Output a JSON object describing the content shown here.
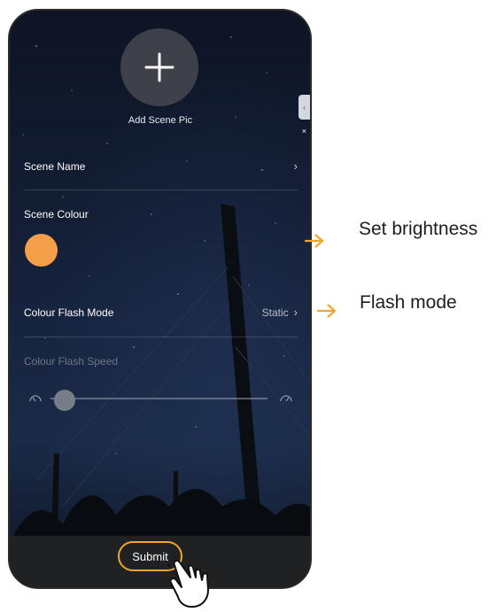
{
  "scene": {
    "add_pic_label": "Add Scene Pic",
    "name_label": "Scene Name",
    "colour_label": "Scene Colour",
    "colour_value": "#f4a04b",
    "flash_mode_label": "Colour Flash Mode",
    "flash_mode_value": "Static",
    "flash_speed_label": "Colour Flash Speed",
    "flash_speed_level": 0.05,
    "chevron": "›",
    "side_tab_glyph": "‹",
    "side_close_glyph": "×"
  },
  "footer": {
    "submit_label": "Submit"
  },
  "annotations": {
    "brightness": "Set brightness",
    "flash_mode": "Flash mode",
    "arrow_color": "#f0a531"
  },
  "icons": [
    "plus-icon",
    "chevron-right-icon",
    "slow-gauge-icon",
    "fast-gauge-icon",
    "tap-hand-icon",
    "arrow-right-icon"
  ]
}
